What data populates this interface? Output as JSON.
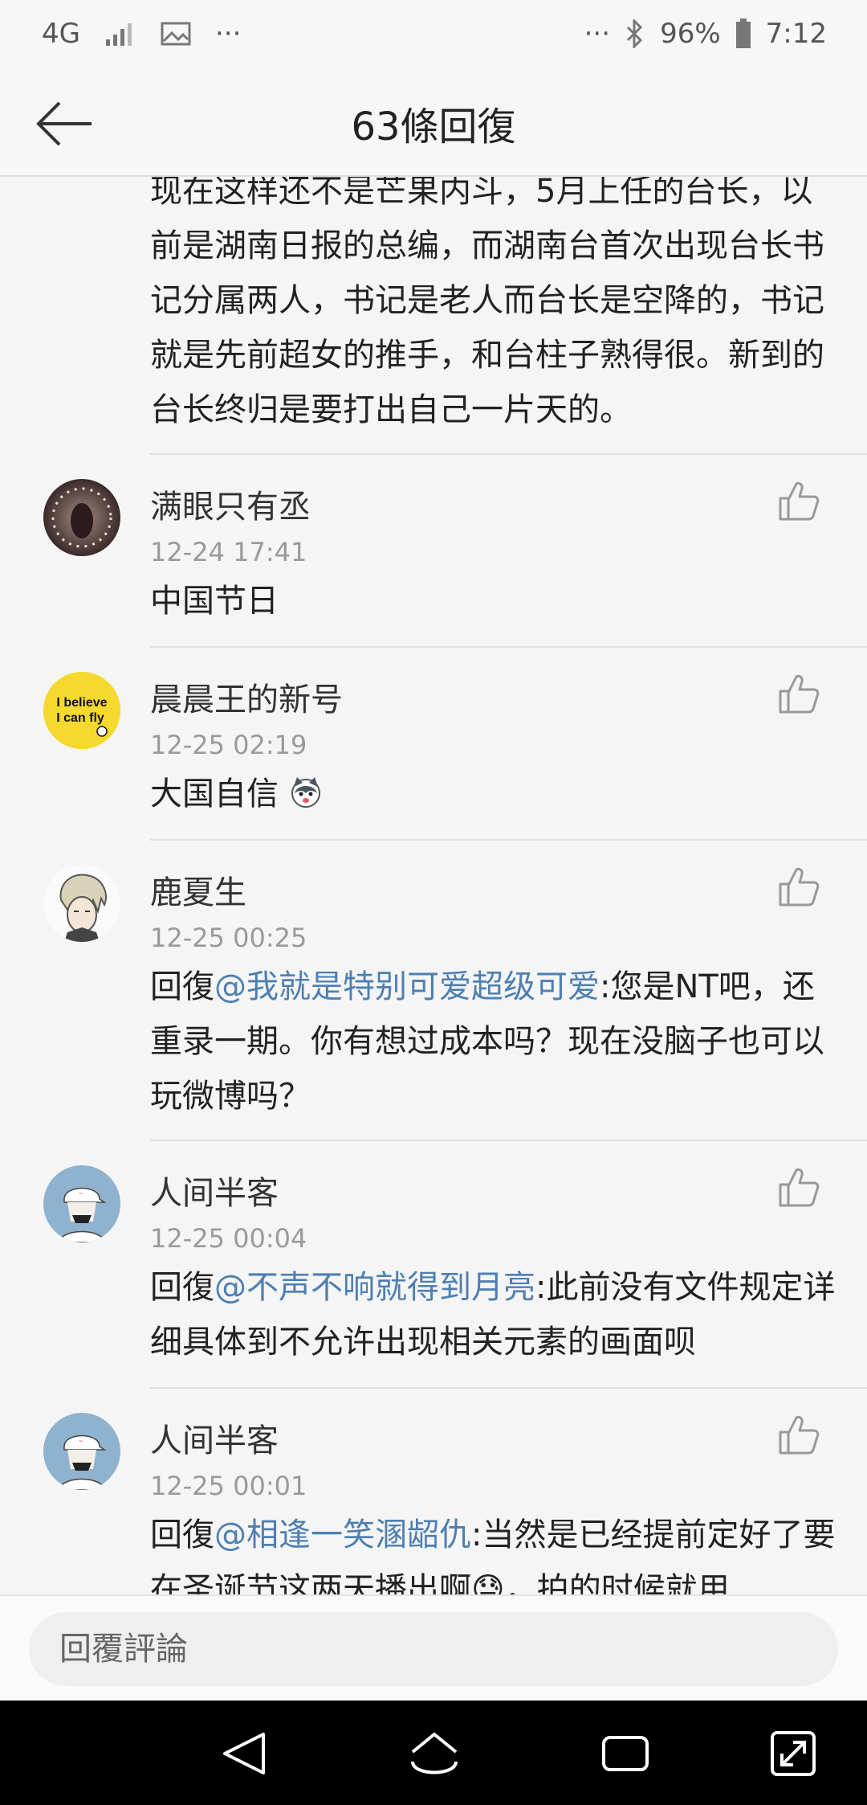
{
  "status_bar": {
    "network": "4G",
    "battery": "96%",
    "time": "7:12",
    "icons": [
      "signal-icon",
      "image-icon",
      "more-dots-icon",
      "bluetooth-icon",
      "battery-icon"
    ]
  },
  "header": {
    "title": "63條回復",
    "back_icon": "back-arrow-icon"
  },
  "partial_comment": {
    "text": "现在这样还不是芒果内斗，5月上任的台长，以前是湖南日报的总编，而湖南台首次出现台长书记分属两人，书记是老人而台长是空降的，书记就是先前超女的推手，和台柱子熟得很。新到的台长终归是要打出自己一片天的。"
  },
  "comments": [
    {
      "name": "满眼只有丞",
      "time": "12-24 17:41",
      "text": "中国节日"
    },
    {
      "name": "晨晨王的新号",
      "time": "12-25 02:19",
      "text": "大国自信",
      "emoji": "husky-emoji",
      "avatar_text": [
        "I believe",
        "I can fly"
      ]
    },
    {
      "name": "鹿夏生",
      "time": "12-25 00:25",
      "reply_prefix": "回復",
      "mention": "@我就是特别可爱超级可爱",
      "text": ":您是NT吧，还重录一期。你有想过成本吗？现在没脑子也可以玩微博吗？"
    },
    {
      "name": "人间半客",
      "time": "12-25 00:04",
      "reply_prefix": "回復",
      "mention": "@不声不响就得到月亮",
      "text": ":此前没有文件规定详细具体到不允许出现相关元素的画面呗"
    },
    {
      "name": "人间半客",
      "time": "12-25 00:01",
      "reply_prefix": "回復",
      "mention": "@相逢一笑溷龆仇",
      "text": ":当然是已经提前定好了要在圣诞节这两天播出啊😓，拍的时候就用"
    }
  ],
  "reply_bar": {
    "placeholder": "回覆評論"
  },
  "nav_bar": {
    "buttons": [
      "back-nav-icon",
      "home-nav-icon",
      "recents-nav-icon",
      "expand-nav-icon"
    ]
  }
}
